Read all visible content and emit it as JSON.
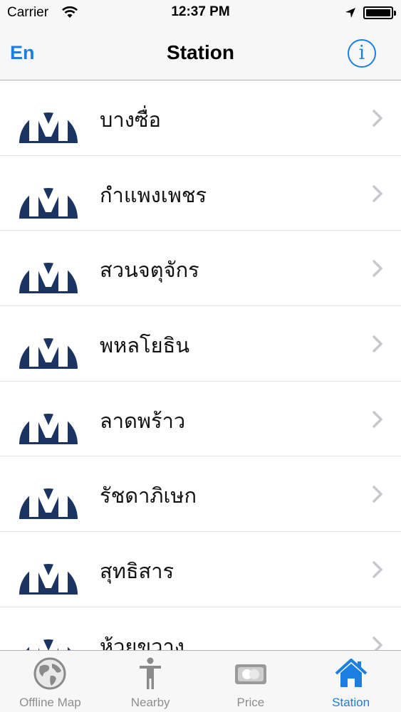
{
  "status": {
    "carrier": "Carrier",
    "time": "12:37 PM"
  },
  "nav": {
    "lang": "En",
    "title": "Station",
    "info": "i"
  },
  "stations": [
    {
      "name": "บางซื่อ"
    },
    {
      "name": "กำแพงเพชร"
    },
    {
      "name": "สวนจตุจักร"
    },
    {
      "name": "พหลโยธิน"
    },
    {
      "name": "ลาดพร้าว"
    },
    {
      "name": "รัชดาภิเษก"
    },
    {
      "name": "สุทธิสาร"
    },
    {
      "name": "ห้วยขวาง"
    }
  ],
  "tabs": [
    {
      "label": "Offline Map",
      "icon": "globe-icon"
    },
    {
      "label": "Nearby",
      "icon": "person-icon"
    },
    {
      "label": "Price",
      "icon": "ticket-card-icon"
    },
    {
      "label": "Station",
      "icon": "home-icon",
      "active": true
    }
  ],
  "colors": {
    "accent": "#1a7fe0",
    "logo_blue": "#1b3462",
    "inactive": "#8e8e8e"
  }
}
